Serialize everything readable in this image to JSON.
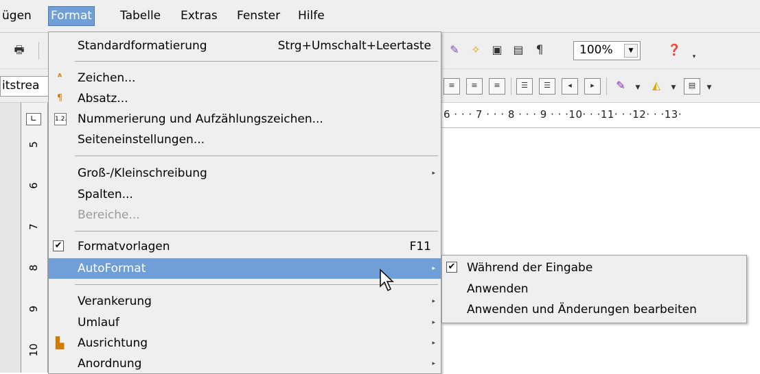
{
  "menubar": {
    "items": [
      "ügen",
      "Format",
      "Tabelle",
      "Extras",
      "Fenster",
      "Hilfe"
    ]
  },
  "toolbar": {
    "zoom_value": "100%",
    "style_box_text": "itstrea",
    "pilcrow": "¶"
  },
  "ruler": {
    "horizontal_ticks": "6 · · · 7 · · · 8 · · · 9 · · ·10· · ·11· · ·12· · ·13·",
    "vertical_numbers": [
      "5",
      "6",
      "7",
      "8",
      "9",
      "10"
    ]
  },
  "format_menu": {
    "items": [
      {
        "type": "item",
        "label": "Standardformatierung",
        "accel": "Strg+Umschalt+Leertaste"
      },
      {
        "type": "item",
        "label": "Zeichen...",
        "icon": "character-icon"
      },
      {
        "type": "item",
        "label": "Absatz...",
        "icon": "paragraph-icon"
      },
      {
        "type": "item",
        "label": "Nummerierung und Aufzählungszeichen...",
        "icon": "numbering-icon"
      },
      {
        "type": "item",
        "label": "Seiteneinstellungen..."
      },
      {
        "type": "item",
        "label": "Groß-/Kleinschreibung",
        "submenu": true
      },
      {
        "type": "item",
        "label": "Spalten..."
      },
      {
        "type": "item",
        "label": "Bereiche...",
        "disabled": true
      },
      {
        "type": "item",
        "label": "Formatvorlagen",
        "accel": "F11",
        "checked": true
      },
      {
        "type": "item",
        "label": "AutoFormat",
        "submenu": true,
        "highlighted": true
      },
      {
        "type": "item",
        "label": "Verankerung",
        "submenu": true
      },
      {
        "type": "item",
        "label": "Umlauf",
        "submenu": true
      },
      {
        "type": "item",
        "label": "Ausrichtung",
        "submenu": true,
        "icon": "align-icon"
      },
      {
        "type": "item",
        "label": "Anordnung",
        "submenu": true
      }
    ]
  },
  "autoformat_submenu": {
    "items": [
      {
        "label": "Während der Eingabe",
        "checked": true
      },
      {
        "label": "Anwenden"
      },
      {
        "label": "Anwenden und Änderungen bearbeiten"
      }
    ]
  },
  "colors": {
    "highlight": "#6f9fd6",
    "menu_bg": "#efefef",
    "disabled": "#9a9a9a"
  }
}
